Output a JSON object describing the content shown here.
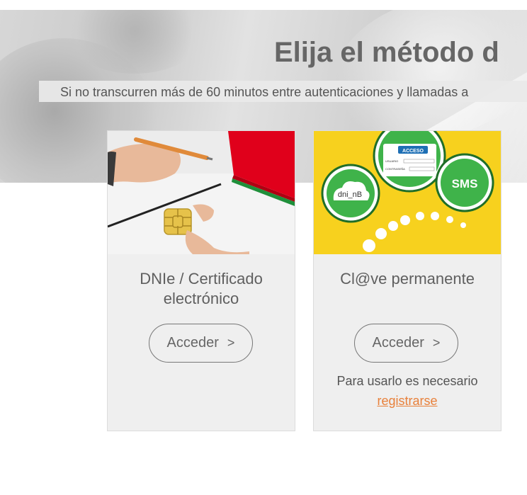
{
  "page": {
    "title": "Elija el método d",
    "subtitle": "Si no transcurren más de 60 minutos entre autenticaciones y llamadas a"
  },
  "cards": [
    {
      "title_line1": "DNIe / Certificado",
      "title_line2": "electrónico",
      "button_label": "Acceder",
      "button_icon": "chevron-right-icon",
      "button_glyph": ">"
    },
    {
      "title_line1": "Cl@ve permanente",
      "button_label": "Acceder",
      "button_icon": "chevron-right-icon",
      "button_glyph": ">",
      "note": "Para usarlo es necesario",
      "link_text": "registrarse",
      "image_labels": {
        "acceso": "ACCESO",
        "usuario": "USUARIO",
        "contrasena": "CONTRASEÑA",
        "sms": "SMS",
        "dni": "dni_nB"
      }
    }
  ],
  "colors": {
    "link": "#e8803a",
    "clave_background": "#f7d11e",
    "clave_green": "#2e9c39"
  }
}
